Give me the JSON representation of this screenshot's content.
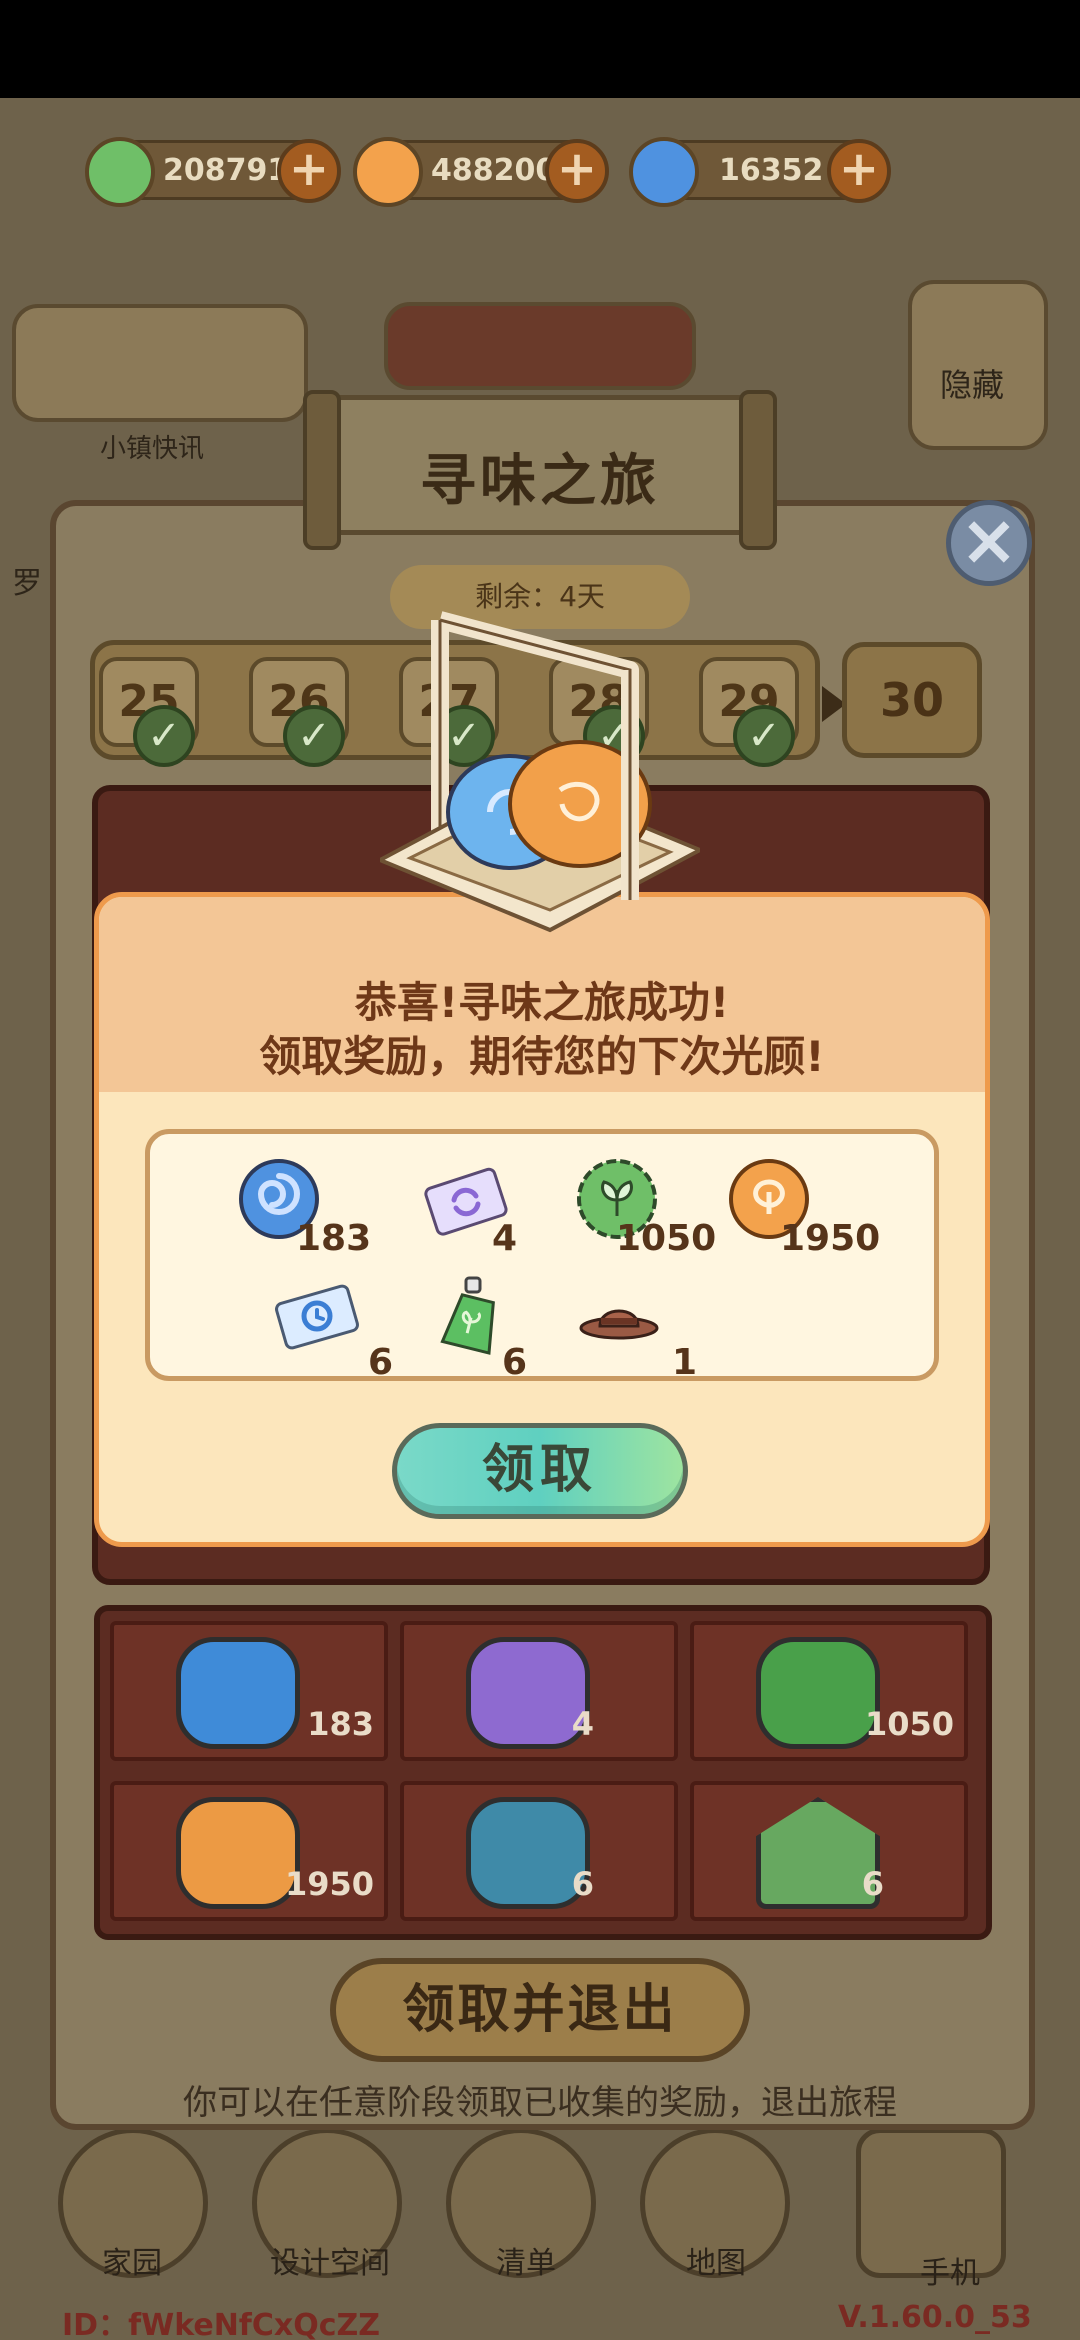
{
  "currencies": [
    {
      "name": "leaf-coin",
      "value": "208791",
      "color": "#6fbf68"
    },
    {
      "name": "orange-coin",
      "value": "488200",
      "color": "#f3a24c"
    },
    {
      "name": "swirl-coin",
      "value": "16352",
      "color": "#4f92e0"
    }
  ],
  "background": {
    "hide_label": "隐藏",
    "town_label": "小镇快讯",
    "left_label": "罗"
  },
  "event": {
    "title": "寻味之旅",
    "remaining": "剩余：4天",
    "days": [
      {
        "label": "25",
        "done": true
      },
      {
        "label": "26",
        "done": true
      },
      {
        "label": "27",
        "done": true
      },
      {
        "label": "28",
        "done": true
      },
      {
        "label": "29",
        "done": true
      }
    ],
    "next_day": "30"
  },
  "collected": [
    {
      "item": "swirl-mooncake",
      "count": "183",
      "color": "#3f8bd8"
    },
    {
      "item": "purple-mooncake",
      "count": "4",
      "color": "#8e6ad0"
    },
    {
      "item": "green-mooncake",
      "count": "1050",
      "color": "#49a04a"
    },
    {
      "item": "orange-mooncake",
      "count": "1950",
      "color": "#ec9a44"
    },
    {
      "item": "teal-mooncake",
      "count": "6",
      "color": "#3f8aa8"
    },
    {
      "item": "green-wedge-cake",
      "count": "6",
      "color": "#67a860"
    }
  ],
  "exit_button": "领取并退出",
  "hint": "你可以在任意阶段领取已收集的奖励，退出旅程",
  "nav": [
    "家园",
    "设计空间",
    "清单",
    "地图",
    "手机"
  ],
  "footer": {
    "id": "ID：fWkeNfCxQcZZ",
    "version": "V.1.60.0_53"
  },
  "popup": {
    "line1": "恭喜!寻味之旅成功!",
    "line2": "领取奖励，期待您的下次光顾!",
    "rewards": [
      {
        "icon": "swirl-coin-icon",
        "count": "183"
      },
      {
        "icon": "refresh-ticket-icon",
        "count": "4"
      },
      {
        "icon": "leaf-coin-icon",
        "count": "1050"
      },
      {
        "icon": "orange-coin-icon",
        "count": "1950"
      },
      {
        "icon": "timer-ticket-icon",
        "count": "6"
      },
      {
        "icon": "sprout-bottle-icon",
        "count": "6"
      },
      {
        "icon": "hat-icon",
        "count": "1"
      }
    ],
    "claim_label": "领取"
  }
}
